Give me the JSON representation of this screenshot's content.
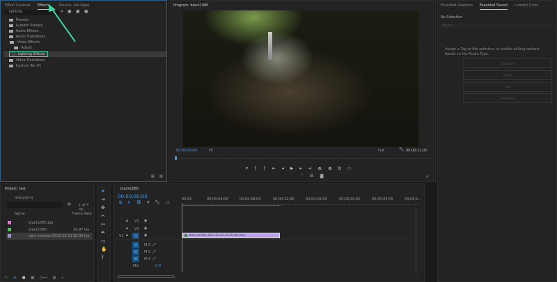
{
  "effects_panel": {
    "tabs": [
      "Effect Controls",
      "Effects",
      "Source: (no clips)"
    ],
    "search_value": "lighting",
    "tree": [
      "Presets",
      "Lumetri Presets",
      "Audio Effects",
      "Audio Transitions",
      "Video Effects",
      "Adjust",
      "Lighting Effects",
      "Video Transitions",
      "Custom Bin 01"
    ]
  },
  "annotation": {
    "arrow_color": "#3fd3a4"
  },
  "program": {
    "title": "Program: black1080",
    "timecode": "00;00;00;00",
    "fit": "Fit",
    "quality": "Full",
    "duration": "00;00;12;00"
  },
  "right_panel": {
    "tabs": [
      "Essential Graphics",
      "Essential Sound",
      "Lumetri Color"
    ],
    "selection": "No Selection",
    "preset_label": "Preset",
    "message": "Assign a Tag to the selection to enable editing options based on the Audio Type.",
    "buttons": [
      "Dialogue",
      "Music",
      "SFX",
      "Ambience"
    ]
  },
  "project": {
    "title": "Project: test",
    "file": "test.prproj",
    "count": "1 of 3 ite...",
    "columns": [
      "Name",
      "Frame Rate"
    ],
    "items": [
      {
        "name": "black1080.jpg",
        "rate": "",
        "color": "#e07ad0"
      },
      {
        "name": "black1080",
        "rate": "29.97 fps",
        "color": "#4ec45e"
      },
      {
        "name": "dark-corridor-2023-02-01-...",
        "rate": "30.00 fps",
        "color": "#a08ee0"
      }
    ]
  },
  "timeline": {
    "sequence": "black1080",
    "timecode": "00;00;00;00",
    "ruler": [
      "00;00",
      "00;00;04;00",
      "00;00;08;00",
      "00;00;12;00",
      "00;00;16;00",
      "00;00;20;00",
      "00;00;24;00",
      "00;00;2..."
    ],
    "video_tracks": [
      "V3",
      "V2",
      "V1"
    ],
    "audio_tracks": [
      "A1",
      "A2",
      "A3"
    ],
    "source_patch": "V1",
    "mix_label": "Mix",
    "mix_value": "0.0",
    "clip": "dark-corridor-2023-02-01-43-10-utc.mov",
    "clip_color": "#b9a2e6"
  }
}
